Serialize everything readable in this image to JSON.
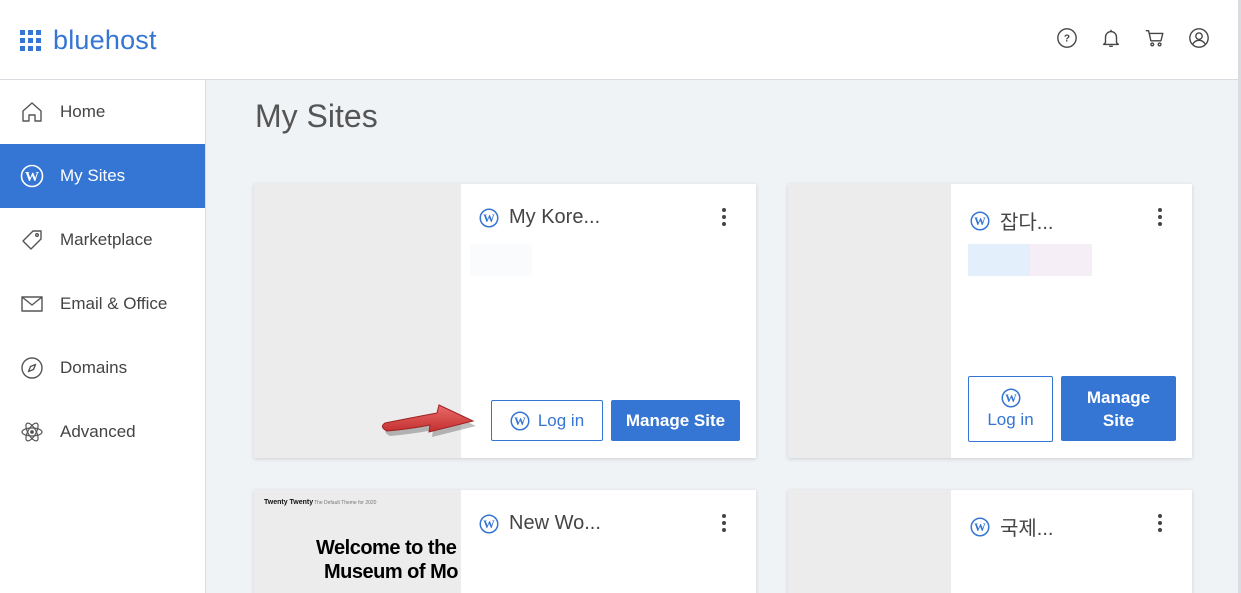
{
  "header": {
    "logo_text": "bluehost",
    "icons": [
      "help-icon",
      "bell-icon",
      "cart-icon",
      "account-icon"
    ],
    "accent": "#3575d3"
  },
  "sidebar": {
    "items": [
      {
        "label": "Home",
        "icon": "home-icon"
      },
      {
        "label": "My Sites",
        "icon": "wordpress-icon",
        "active": true
      },
      {
        "label": "Marketplace",
        "icon": "tag-icon"
      },
      {
        "label": "Email & Office",
        "icon": "envelope-icon"
      },
      {
        "label": "Domains",
        "icon": "compass-icon"
      },
      {
        "label": "Advanced",
        "icon": "atom-icon"
      }
    ]
  },
  "main": {
    "title": "My Sites",
    "sites": [
      {
        "name": "My Kore...",
        "login_label": "Log in",
        "manage_label": "Manage Site"
      },
      {
        "name": "잡다...",
        "login_label": "Log in",
        "manage_label": "Manage Site"
      },
      {
        "name": "New Wo...",
        "preview": {
          "site_title": "Twenty Twenty",
          "tagline": "The Default Theme for 2020",
          "heading_line1": "Welcome to the",
          "heading_line2": "Museum of Mo"
        }
      },
      {
        "name": "국제..."
      }
    ]
  }
}
